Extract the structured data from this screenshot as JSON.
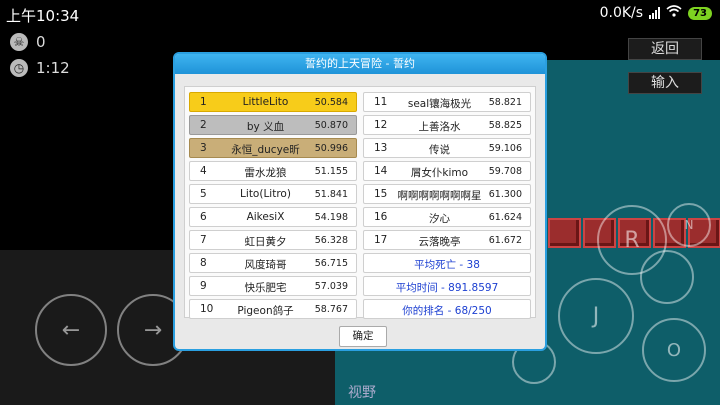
{
  "statusbar": {
    "time": "上午10:34",
    "net_speed": "0.0K/s",
    "battery": "73"
  },
  "hud": {
    "deaths": "0",
    "timer": "1:12"
  },
  "side_buttons": {
    "back": "返回",
    "input": "输入"
  },
  "controls": {
    "left": "←",
    "right": "→",
    "r": "R",
    "n": "N",
    "j": "J",
    "o": "O",
    "view": "视野"
  },
  "dialog": {
    "title": "誓约的上天冒险 - 誓约",
    "ok_label": "确定",
    "left_rows": [
      {
        "rank": "1",
        "name": "LittleLito",
        "time": "50.584"
      },
      {
        "rank": "2",
        "name": "by 义血",
        "time": "50.870"
      },
      {
        "rank": "3",
        "name": "永恒_ducye昕",
        "time": "50.996"
      },
      {
        "rank": "4",
        "name": "雷水龙狼",
        "time": "51.155"
      },
      {
        "rank": "5",
        "name": "Lito(Litro)",
        "time": "51.841"
      },
      {
        "rank": "6",
        "name": "AikesiX",
        "time": "54.198"
      },
      {
        "rank": "7",
        "name": "虹日黄夕",
        "time": "56.328"
      },
      {
        "rank": "8",
        "name": "风度琦哥",
        "time": "56.715"
      },
      {
        "rank": "9",
        "name": "快乐肥宅",
        "time": "57.039"
      },
      {
        "rank": "10",
        "name": "Pigeon鸽子",
        "time": "58.767"
      }
    ],
    "right_rows": [
      {
        "rank": "11",
        "name": "seal镶海极光",
        "time": "58.821"
      },
      {
        "rank": "12",
        "name": "上善洛水",
        "time": "58.825"
      },
      {
        "rank": "13",
        "name": "传说",
        "time": "59.106"
      },
      {
        "rank": "14",
        "name": "屑女仆kimo",
        "time": "59.708"
      },
      {
        "rank": "15",
        "name": "啊啊啊啊啊啊啊星",
        "time": "61.300"
      },
      {
        "rank": "16",
        "name": "汐心",
        "time": "61.624"
      },
      {
        "rank": "17",
        "name": "云落晚亭",
        "time": "61.672"
      }
    ],
    "stats": {
      "avg_deaths": "平均死亡 - 38",
      "avg_time": "平均时间 - 891.8597",
      "your_rank": "你的排名 - 68/250"
    }
  },
  "colors": {
    "gold": "#f7cc1a",
    "silver": "#bdbdbd",
    "bronze": "#c9ae78",
    "title_bar": "#2a9fe0",
    "stat_text": "#1c3fd1"
  }
}
